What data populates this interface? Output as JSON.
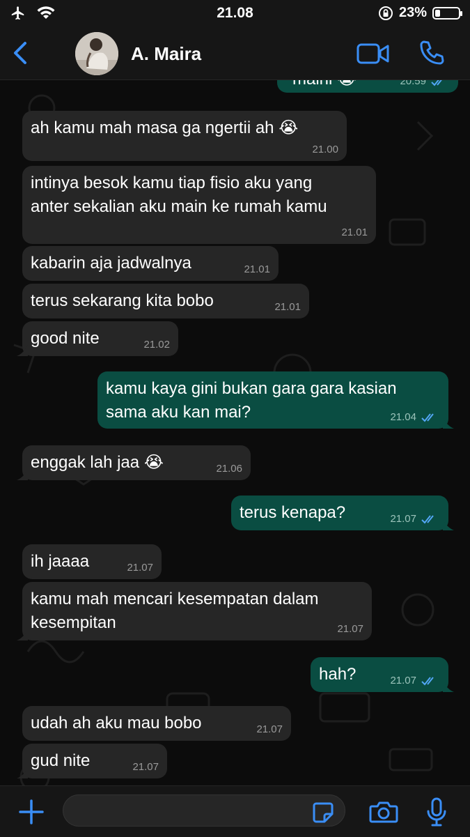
{
  "status_bar": {
    "time": "21.08",
    "battery_text": "23%",
    "battery_level": 0.23
  },
  "header": {
    "contact_name": "A. Maira"
  },
  "colors": {
    "accent": "#3a8ef6",
    "incoming": "#262626",
    "outgoing": "#0a4d42",
    "tick": "#53a6f5"
  },
  "messages": [
    {
      "text": "maini",
      "time": "20.59",
      "direction": "out",
      "emoji": "😭"
    },
    {
      "text": "ah kamu mah masa ga ngertii ah",
      "emoji": "😭",
      "time": "21.00",
      "direction": "in"
    },
    {
      "text": "intinya besok kamu tiap fisio aku yang\nanter sekalian aku main ke rumah kamu",
      "time": "21.01",
      "direction": "in"
    },
    {
      "text": "kabarin aja jadwalnya",
      "time": "21.01",
      "direction": "in"
    },
    {
      "text": "terus sekarang kita bobo",
      "time": "21.01",
      "direction": "in"
    },
    {
      "text": "good nite",
      "time": "21.02",
      "direction": "in"
    },
    {
      "text": "kamu kaya gini bukan gara gara kasian\nsama aku kan mai?",
      "time": "21.04",
      "direction": "out"
    },
    {
      "text": "enggak lah jaa",
      "emoji": "😭",
      "time": "21.06",
      "direction": "in"
    },
    {
      "text": "terus kenapa?",
      "time": "21.07",
      "direction": "out"
    },
    {
      "text": "ih jaaaa",
      "time": "21.07",
      "direction": "in"
    },
    {
      "text": "kamu mah mencari kesempatan dalam\nkesempitan",
      "time": "21.07",
      "direction": "in"
    },
    {
      "text": "hah?",
      "time": "21.07",
      "direction": "out"
    },
    {
      "text": "udah ah aku mau bobo",
      "time": "21.07",
      "direction": "in"
    },
    {
      "text": "gud nite",
      "time": "21.07",
      "direction": "in"
    }
  ],
  "composer": {
    "placeholder": ""
  },
  "icons": {
    "airplane": "airplane-icon",
    "wifi": "wifi-icon",
    "lock": "orientation-lock-icon",
    "back": "chevron-left-icon",
    "video": "video-camera-icon",
    "call": "phone-icon",
    "plus": "plus-icon",
    "sticker": "sticker-icon",
    "camera": "camera-icon",
    "mic": "microphone-icon",
    "read": "double-check-icon"
  }
}
